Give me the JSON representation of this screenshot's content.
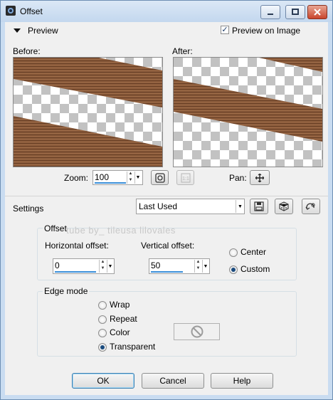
{
  "window": {
    "title": "Offset"
  },
  "preview_section": {
    "header": "Preview",
    "preview_on_image_label": "Preview on Image",
    "preview_on_image_checked": true,
    "before_label": "Before:",
    "after_label": "After:",
    "zoom_label": "Zoom:",
    "zoom_value": "100",
    "pan_label": "Pan:"
  },
  "settings": {
    "label": "Settings",
    "preset_value": "Last Used"
  },
  "offset": {
    "group_label": "Offset",
    "watermark": "tube by_ tileusa lilovales",
    "horizontal_label": "Horizontal offset:",
    "horizontal_value": "0",
    "vertical_label": "Vertical offset:",
    "vertical_value": "50",
    "modes": [
      "Center",
      "Custom"
    ],
    "selected_mode": "Custom"
  },
  "edge_mode": {
    "group_label": "Edge mode",
    "options": [
      "Wrap",
      "Repeat",
      "Color",
      "Transparent"
    ],
    "selected": "Transparent"
  },
  "buttons": {
    "ok": "OK",
    "cancel": "Cancel",
    "help": "Help"
  },
  "colors": {
    "wood": "#8a5a3a",
    "accent": "#3a8ed8",
    "checker_dark": "#bdbdbd"
  }
}
